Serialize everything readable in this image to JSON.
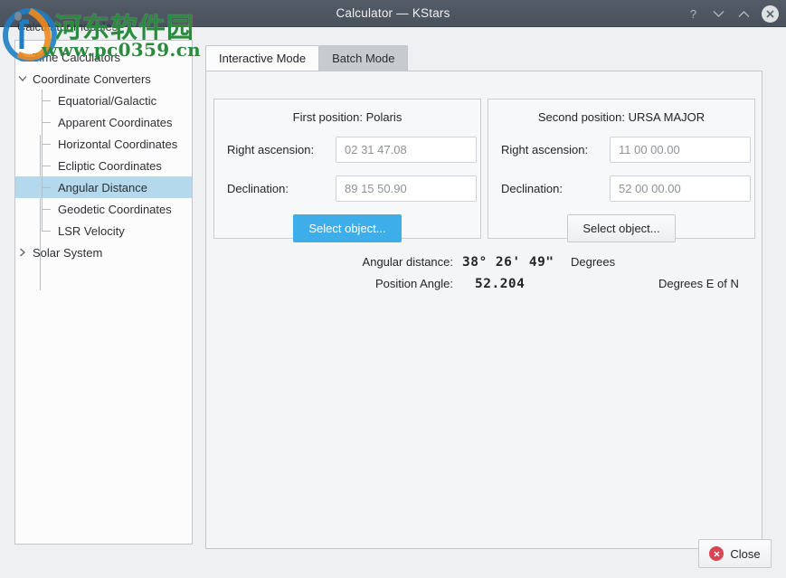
{
  "window": {
    "title": "Calculator — KStars",
    "buttons": {
      "help": "?",
      "minimize": "∨",
      "maximize": "∧",
      "close": "✕"
    }
  },
  "sidebar": {
    "header": "Calculator modules",
    "items": [
      {
        "label": "Time Calculators",
        "level": 0,
        "expander": "collapsed",
        "selected": false
      },
      {
        "label": "Coordinate Converters",
        "level": 0,
        "expander": "expanded",
        "selected": false
      },
      {
        "label": "Equatorial/Galactic",
        "level": 1,
        "expander": "none",
        "selected": false
      },
      {
        "label": "Apparent Coordinates",
        "level": 1,
        "expander": "none",
        "selected": false
      },
      {
        "label": "Horizontal Coordinates",
        "level": 1,
        "expander": "none",
        "selected": false
      },
      {
        "label": "Ecliptic Coordinates",
        "level": 1,
        "expander": "none",
        "selected": false
      },
      {
        "label": "Angular Distance",
        "level": 1,
        "expander": "none",
        "selected": true
      },
      {
        "label": "Geodetic Coordinates",
        "level": 1,
        "expander": "none",
        "selected": false
      },
      {
        "label": "LSR Velocity",
        "level": 1,
        "expander": "none",
        "selected": false,
        "last": true
      },
      {
        "label": "Solar System",
        "level": 0,
        "expander": "collapsed",
        "selected": false
      }
    ]
  },
  "tabs": [
    {
      "label": "Interactive Mode",
      "active": true
    },
    {
      "label": "Batch Mode",
      "active": false
    }
  ],
  "first_position": {
    "title": "First position: Polaris",
    "ra_label": "Right ascension:",
    "ra_value": "02 31 47.08",
    "dec_label": "Declination:",
    "dec_value": "89 15 50.90",
    "select_button": "Select object..."
  },
  "second_position": {
    "title": "Second position: URSA MAJOR",
    "ra_label": "Right ascension:",
    "ra_value": "11 00 00.00",
    "dec_label": "Declination:",
    "dec_value": "52 00 00.00",
    "select_button": "Select object..."
  },
  "results": {
    "angular_distance_label": "Angular distance:",
    "angular_distance_value": "38° 26' 49\"",
    "angular_distance_unit": "Degrees",
    "position_angle_label": "Position Angle:",
    "position_angle_value": "52.204",
    "position_angle_unit": "Degrees E of N"
  },
  "footer": {
    "close_label": "Close"
  },
  "watermark": {
    "chinese": "河东软件园",
    "url": "www.pc0359.cn"
  },
  "colors": {
    "titlebar": "#4d5560",
    "accent": "#3daee9",
    "selection": "#b4d8ec",
    "close_red": "#da4453",
    "watermark_green": "#2a8a3e"
  }
}
